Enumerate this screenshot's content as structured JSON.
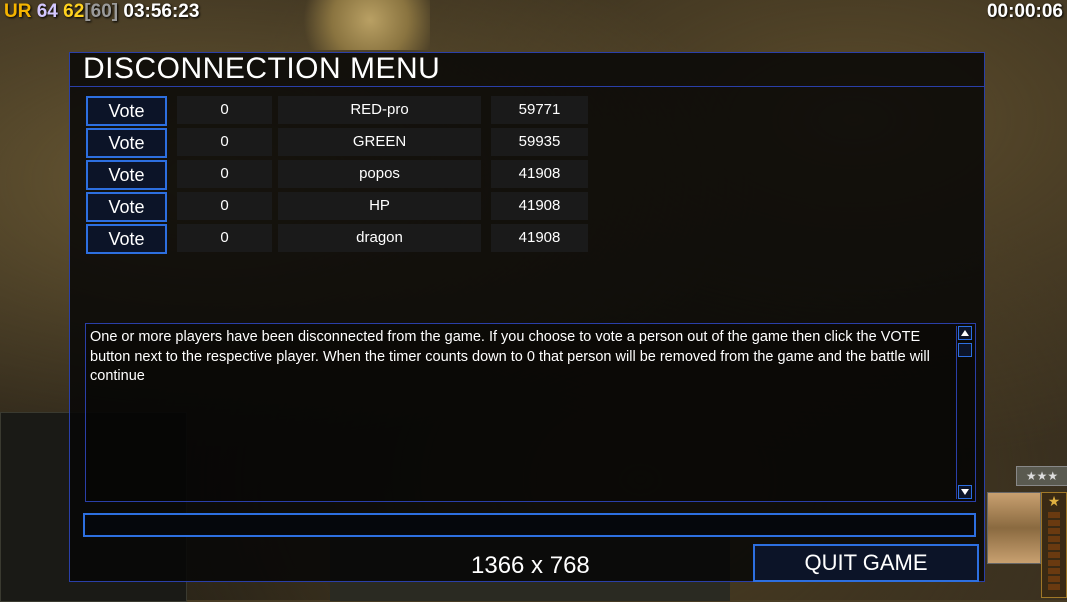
{
  "hud": {
    "ur_label": "UR",
    "val64": "64",
    "val62": "62",
    "val60": "[60]",
    "clock": "03:56:23",
    "timer": "00:00:06"
  },
  "dialog": {
    "title": "DISCONNECTION MENU",
    "vote_label": "Vote",
    "players": [
      {
        "count": "0",
        "name": "RED-pro",
        "ping": "59771"
      },
      {
        "count": "0",
        "name": "GREEN",
        "ping": "59935"
      },
      {
        "count": "0",
        "name": "popos",
        "ping": "41908"
      },
      {
        "count": "0",
        "name": "HP",
        "ping": "41908"
      },
      {
        "count": "0",
        "name": "dragon",
        "ping": "41908"
      }
    ],
    "message": "One or more players have been disconnected from the game. If you choose to vote a person out of the game then click the VOTE button next to the respective player. When the timer counts down to 0 that person will be removed from the game and the battle will continue",
    "chat_value": "",
    "resolution": "1366 x 768",
    "quit_label": "QUIT GAME"
  },
  "background": {
    "rank_stars": "★★★",
    "rank_icon": "★"
  },
  "colors": {
    "accent": "#2d6fe0",
    "border": "#2a3fa8"
  }
}
